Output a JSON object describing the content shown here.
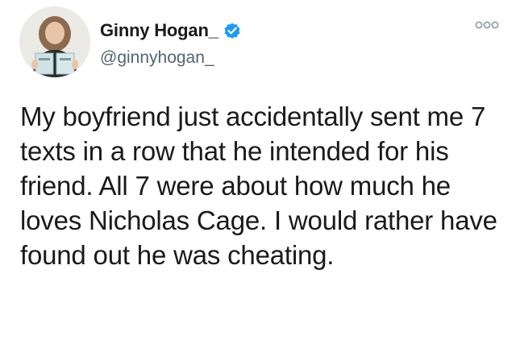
{
  "tweet": {
    "author": {
      "display_name": "Ginny Hogan_",
      "handle": "@ginnyhogan_",
      "verified": true,
      "avatar_icon": "author-avatar-photo"
    },
    "text": "My boyfriend just accidentally sent me 7 texts in a row that he intended for his friend. All 7 were about how much he loves Nicholas Cage. I would rather have found out he was cheating."
  },
  "colors": {
    "verified_badge": "#1d9bf0",
    "handle_gray": "#536471",
    "text": "#1a1a1a"
  }
}
